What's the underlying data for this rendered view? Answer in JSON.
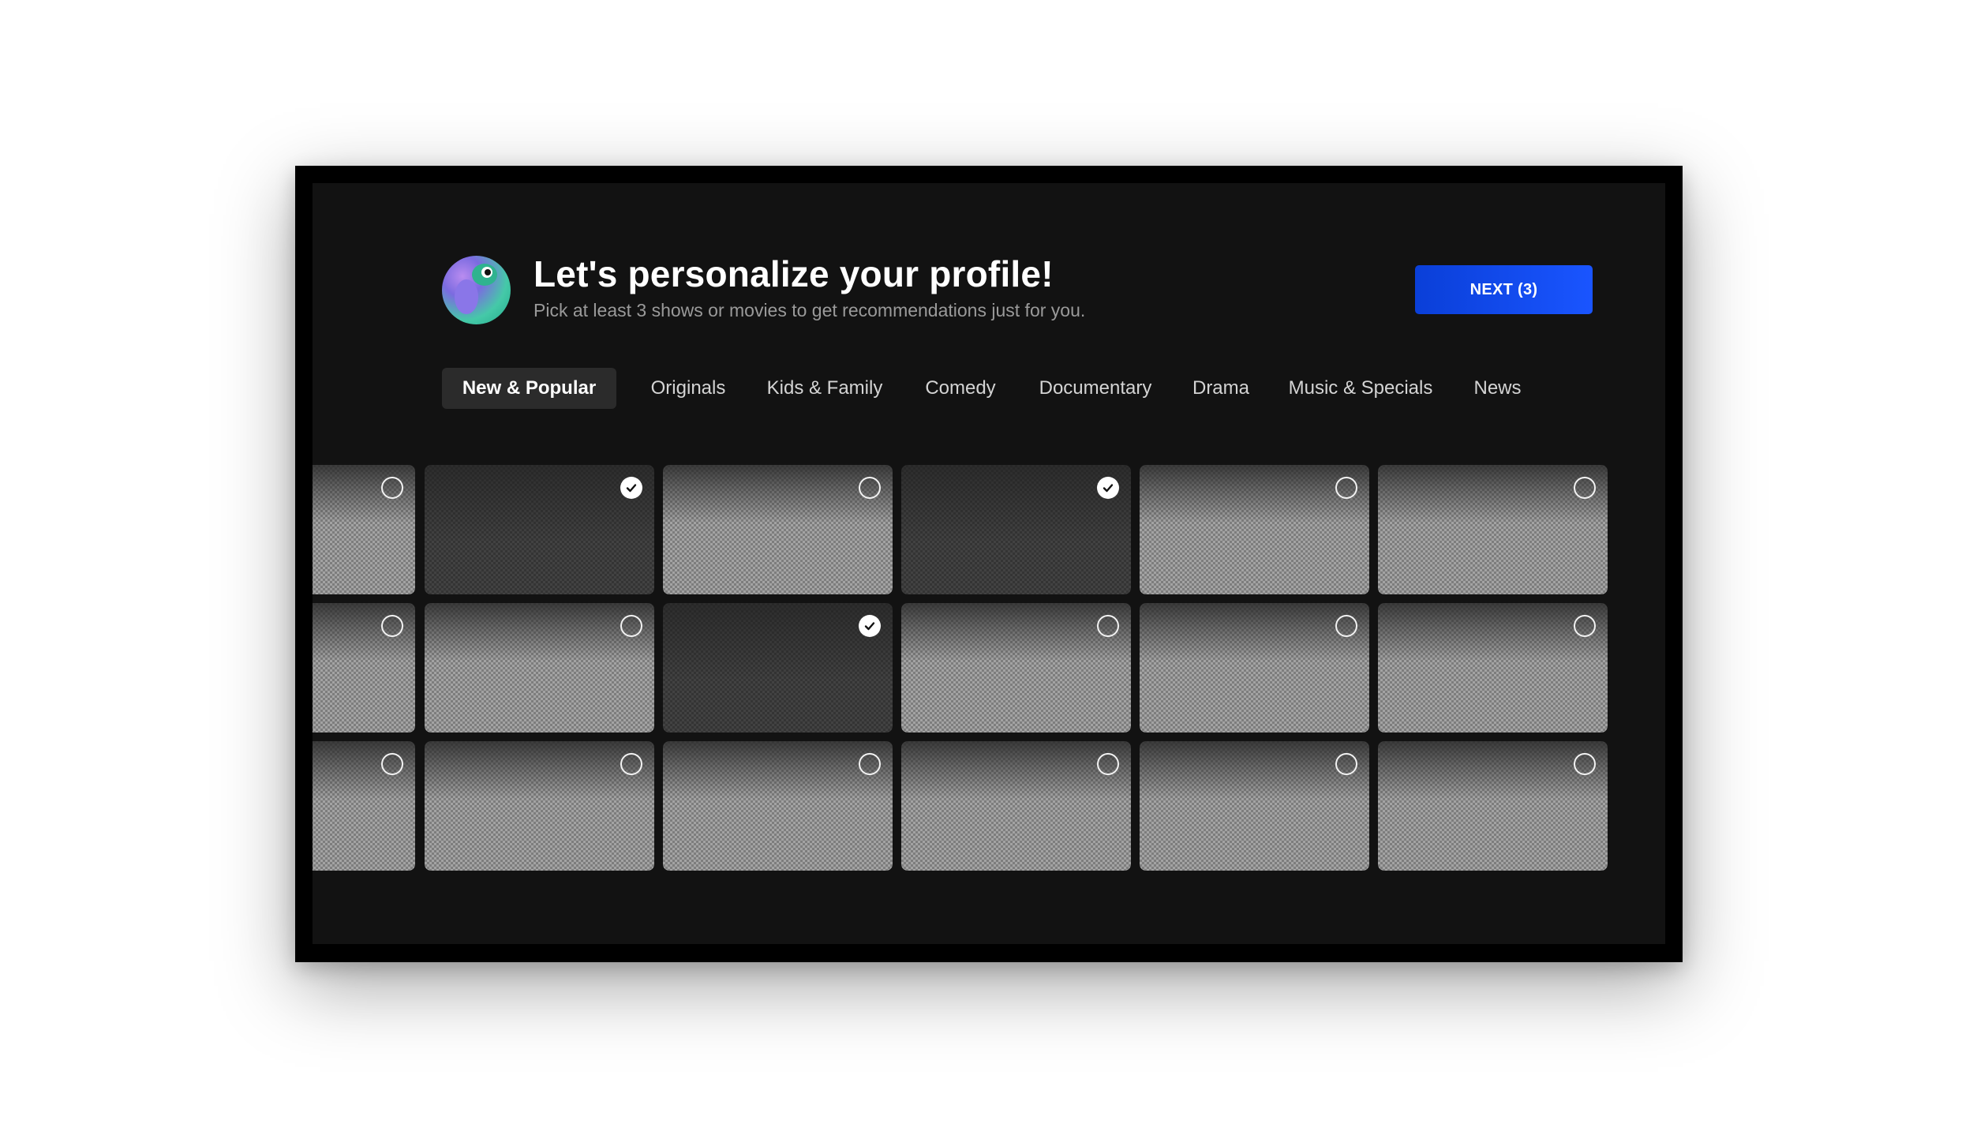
{
  "header": {
    "title": "Let's personalize your profile!",
    "subtitle": "Pick at least 3 shows or movies to get recommendations just for you.",
    "next_button": "NEXT (3)"
  },
  "avatar": {
    "icon": "parrot-avatar-icon"
  },
  "tabs": [
    {
      "label": "New & Popular",
      "active": true
    },
    {
      "label": "Originals",
      "active": false
    },
    {
      "label": "Kids & Family",
      "active": false
    },
    {
      "label": "Comedy",
      "active": false
    },
    {
      "label": "Documentary",
      "active": false
    },
    {
      "label": "Drama",
      "active": false
    },
    {
      "label": "Music & Specials",
      "active": false
    },
    {
      "label": "News",
      "active": false
    }
  ],
  "grid": {
    "rows": [
      [
        false,
        true,
        false,
        true,
        false,
        false
      ],
      [
        false,
        false,
        true,
        false,
        false,
        false
      ],
      [
        false,
        false,
        false,
        false,
        false,
        false
      ]
    ],
    "selected_count": 3
  },
  "colors": {
    "screen_bg": "#121212",
    "accent": "#0a3fd8",
    "tab_active_bg": "#2b2b2b"
  }
}
